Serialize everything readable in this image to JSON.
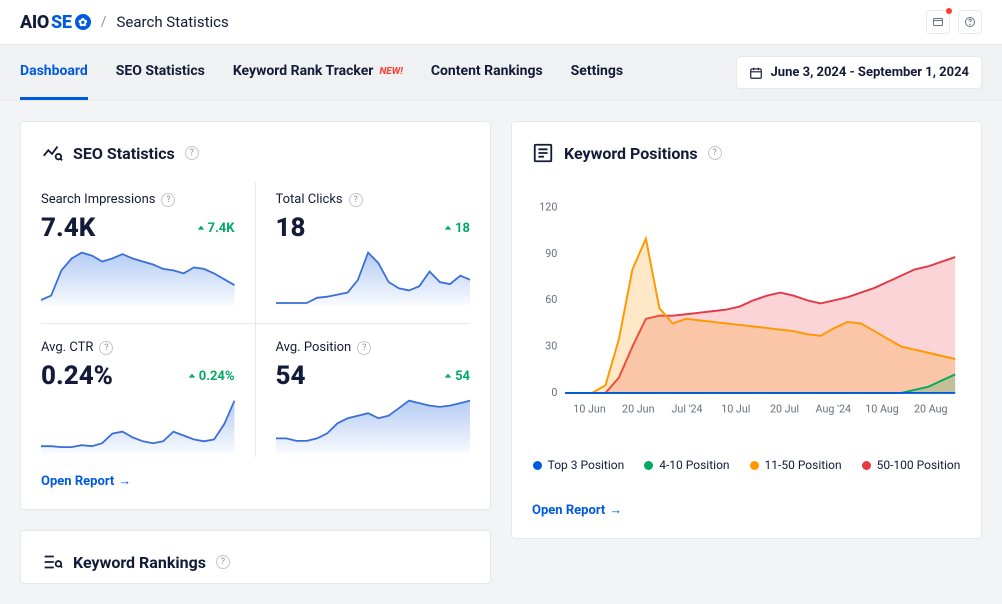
{
  "header": {
    "logo_aio": "AIO",
    "logo_seo": "SE",
    "breadcrumb": "Search Statistics"
  },
  "tabs": [
    {
      "label": "Dashboard",
      "active": true
    },
    {
      "label": "SEO Statistics",
      "active": false
    },
    {
      "label": "Keyword Rank Tracker",
      "active": false,
      "badge": "NEW!"
    },
    {
      "label": "Content Rankings",
      "active": false
    },
    {
      "label": "Settings",
      "active": false
    }
  ],
  "daterange": "June 3, 2024 - September 1, 2024",
  "seo_card": {
    "title": "SEO Statistics",
    "open_report": "Open Report",
    "stats": [
      {
        "label": "Search Impressions",
        "value": "7.4K",
        "change": "7.4K"
      },
      {
        "label": "Total Clicks",
        "value": "18",
        "change": "18"
      },
      {
        "label": "Avg. CTR",
        "value": "0.24%",
        "change": "0.24%"
      },
      {
        "label": "Avg. Position",
        "value": "54",
        "change": "54"
      }
    ]
  },
  "rankings_card": {
    "title": "Keyword Rankings"
  },
  "kp_card": {
    "title": "Keyword Positions",
    "open_report": "Open Report",
    "legend": [
      {
        "label": "Top 3 Position",
        "color": "#005ae0"
      },
      {
        "label": "4-10 Position",
        "color": "#00aa63"
      },
      {
        "label": "11-50 Position",
        "color": "#ff9800"
      },
      {
        "label": "50-100 Position",
        "color": "#e63946"
      }
    ]
  },
  "chart_data": {
    "type": "area",
    "x_labels": [
      "10 Jun",
      "20 Jun",
      "Jul '24",
      "10 Jul",
      "20 Jul",
      "Aug '24",
      "10 Aug",
      "20 Aug"
    ],
    "ylim": [
      0,
      120
    ],
    "y_ticks": [
      0,
      30,
      60,
      90,
      120
    ],
    "series": [
      {
        "name": "Top 3 Position",
        "color": "#005ae0",
        "values": [
          0,
          0,
          0,
          0,
          0,
          0,
          0,
          0,
          0,
          0,
          0,
          0,
          0,
          0,
          0,
          0,
          0,
          0,
          0,
          0,
          0,
          0,
          0,
          0,
          0,
          0,
          0,
          0,
          0,
          0
        ]
      },
      {
        "name": "4-10 Position",
        "color": "#00aa63",
        "values": [
          0,
          0,
          0,
          0,
          0,
          0,
          0,
          0,
          0,
          0,
          0,
          0,
          0,
          0,
          0,
          0,
          0,
          0,
          0,
          0,
          0,
          0,
          0,
          0,
          0,
          0,
          2,
          4,
          8,
          12
        ]
      },
      {
        "name": "11-50 Position",
        "color": "#ff9800",
        "values": [
          0,
          0,
          0,
          5,
          35,
          80,
          100,
          55,
          45,
          48,
          47,
          46,
          45,
          44,
          43,
          42,
          41,
          40,
          38,
          37,
          42,
          46,
          45,
          40,
          35,
          30,
          28,
          26,
          24,
          22
        ]
      },
      {
        "name": "50-100 Position",
        "color": "#e63946",
        "values": [
          0,
          0,
          0,
          0,
          10,
          30,
          48,
          50,
          50,
          51,
          52,
          53,
          54,
          56,
          60,
          63,
          65,
          63,
          60,
          58,
          60,
          62,
          65,
          68,
          72,
          76,
          80,
          82,
          85,
          88
        ]
      }
    ]
  },
  "sparks": [
    [
      2,
      5,
      22,
      30,
      34,
      32,
      28,
      30,
      33,
      30,
      28,
      26,
      23,
      22,
      20,
      24,
      23,
      20,
      16,
      12
    ],
    [
      0,
      0,
      0,
      0,
      5,
      6,
      8,
      10,
      22,
      48,
      38,
      20,
      14,
      12,
      16,
      30,
      20,
      18,
      26,
      22
    ],
    [
      5,
      5,
      4,
      4,
      6,
      5,
      8,
      18,
      20,
      14,
      10,
      8,
      10,
      20,
      16,
      12,
      10,
      12,
      28,
      52
    ],
    [
      10,
      10,
      8,
      8,
      10,
      14,
      22,
      26,
      28,
      30,
      26,
      28,
      34,
      40,
      38,
      36,
      35,
      36,
      38,
      40
    ]
  ]
}
